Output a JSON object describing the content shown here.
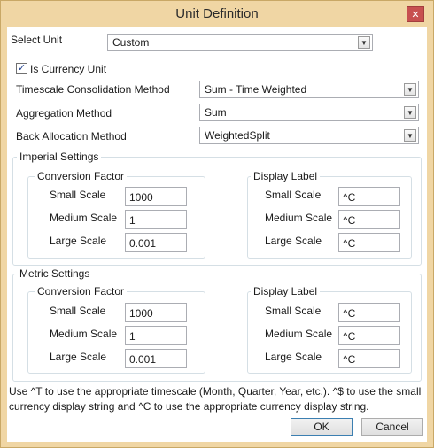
{
  "window": {
    "title": "Unit Definition",
    "close_glyph": "✕"
  },
  "select_unit": {
    "label": "Select Unit",
    "value": "Custom"
  },
  "is_currency": {
    "label": "Is Currency Unit",
    "checked": true
  },
  "timescale": {
    "label": "Timescale Consolidation Method",
    "value": "Sum - Time Weighted"
  },
  "aggregation": {
    "label": "Aggregation Method",
    "value": "Sum"
  },
  "back_allocation": {
    "label": "Back Allocation Method",
    "value": "WeightedSplit"
  },
  "imperial": {
    "title": "Imperial Settings",
    "conversion_title": "Conversion Factor",
    "display_title": "Display Label",
    "small_label": "Small Scale",
    "medium_label": "Medium Scale",
    "large_label": "Large Scale",
    "small_value": "1000",
    "medium_value": "1",
    "large_value": "0.001",
    "small_display": "^C",
    "medium_display": "^C",
    "large_display": "^C"
  },
  "metric": {
    "title": "Metric Settings",
    "conversion_title": "Conversion Factor",
    "display_title": "Display Label",
    "small_label": "Small Scale",
    "medium_label": "Medium Scale",
    "large_label": "Large Scale",
    "small_value": "1000",
    "medium_value": "1",
    "large_value": "0.001",
    "small_display": "^C",
    "medium_display": "^C",
    "large_display": "^C"
  },
  "note": {
    "line1": "Use ^T to use the appropriate timescale (Month, Quarter, Year, etc.). ^$ to use the small",
    "line2": "currency display string and ^C to use the appropriate currency display string."
  },
  "buttons": {
    "ok": "OK",
    "cancel": "Cancel"
  },
  "icons": {
    "close": "close-icon",
    "dropdown": "chevron-down-icon",
    "check": "checkmark-icon"
  }
}
